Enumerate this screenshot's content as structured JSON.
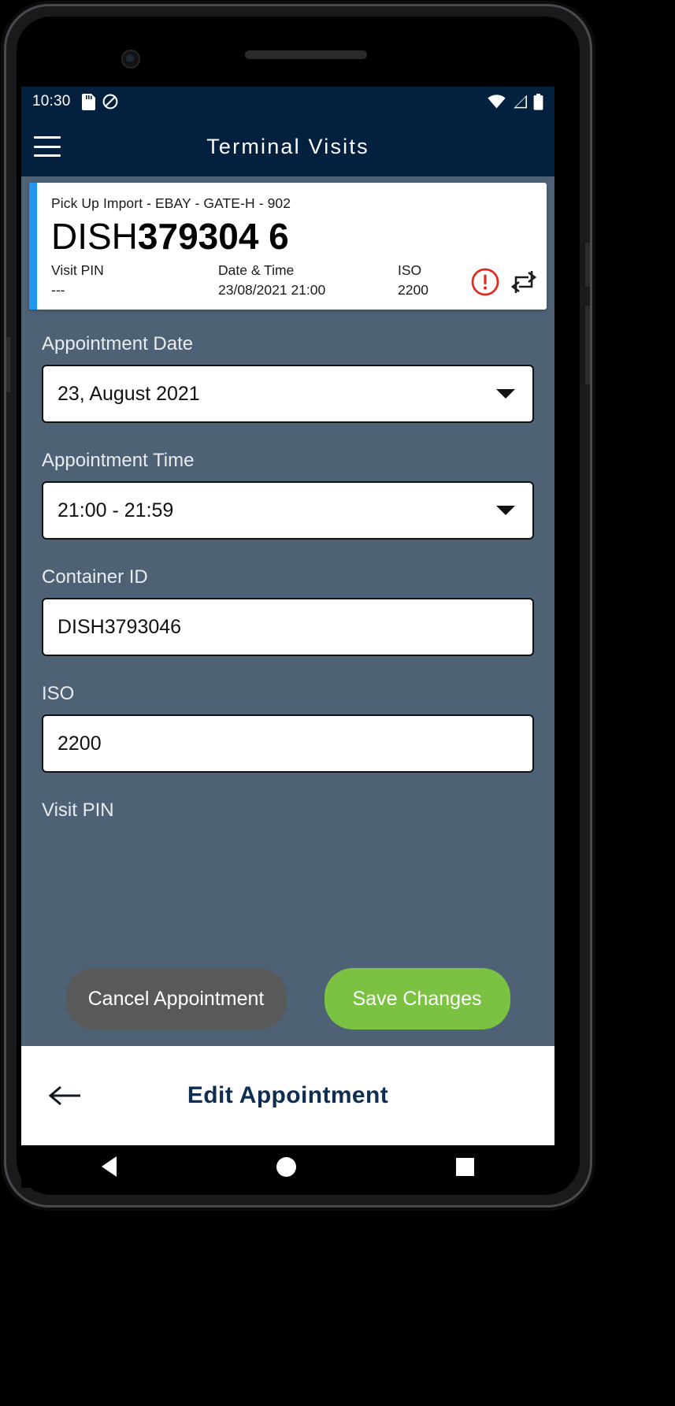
{
  "status_bar": {
    "time": "10:30",
    "left_icons": [
      "sd-card-icon",
      "do-not-disturb-icon"
    ],
    "right_icons": [
      "wifi-icon",
      "cellular-signal-icon",
      "battery-icon"
    ]
  },
  "app_bar": {
    "menu_icon": "hamburger-menu-icon",
    "title": "Terminal Visits"
  },
  "visit_card": {
    "accent_color": "#2196f3",
    "subheader": "Pick Up Import - EBAY - GATE-H - 902",
    "container_prefix": "DISH",
    "container_number": "379304 6",
    "meta": [
      {
        "label": "Visit PIN",
        "value": "---"
      },
      {
        "label": "Date & Time",
        "value": "23/08/2021 21:00"
      },
      {
        "label": "ISO",
        "value": "2200"
      }
    ],
    "icons": [
      {
        "name": "error-alert-icon",
        "color": "#e02b20"
      },
      {
        "name": "transfer-swap-icon",
        "color": "#1b1b1b"
      }
    ]
  },
  "form": {
    "fields": [
      {
        "label": "Appointment Date",
        "value": "23, August 2021",
        "type": "dropdown"
      },
      {
        "label": "Appointment Time",
        "value": "21:00 - 21:59",
        "type": "dropdown"
      },
      {
        "label": "Container ID",
        "value": "DISH3793046",
        "type": "text"
      },
      {
        "label": "ISO",
        "value": "2200",
        "type": "text"
      },
      {
        "label": "Visit PIN",
        "value": "",
        "type": "text"
      }
    ]
  },
  "actions": {
    "cancel_label": "Cancel Appointment",
    "cancel_color": "#595959",
    "save_label": "Save Changes",
    "save_color": "#7cc242"
  },
  "bottom_bar": {
    "back_icon": "back-arrow-icon",
    "title": "Edit Appointment"
  },
  "nav_bar": {
    "back": "nav-back-icon",
    "home": "nav-home-icon",
    "recents": "nav-recents-icon"
  }
}
